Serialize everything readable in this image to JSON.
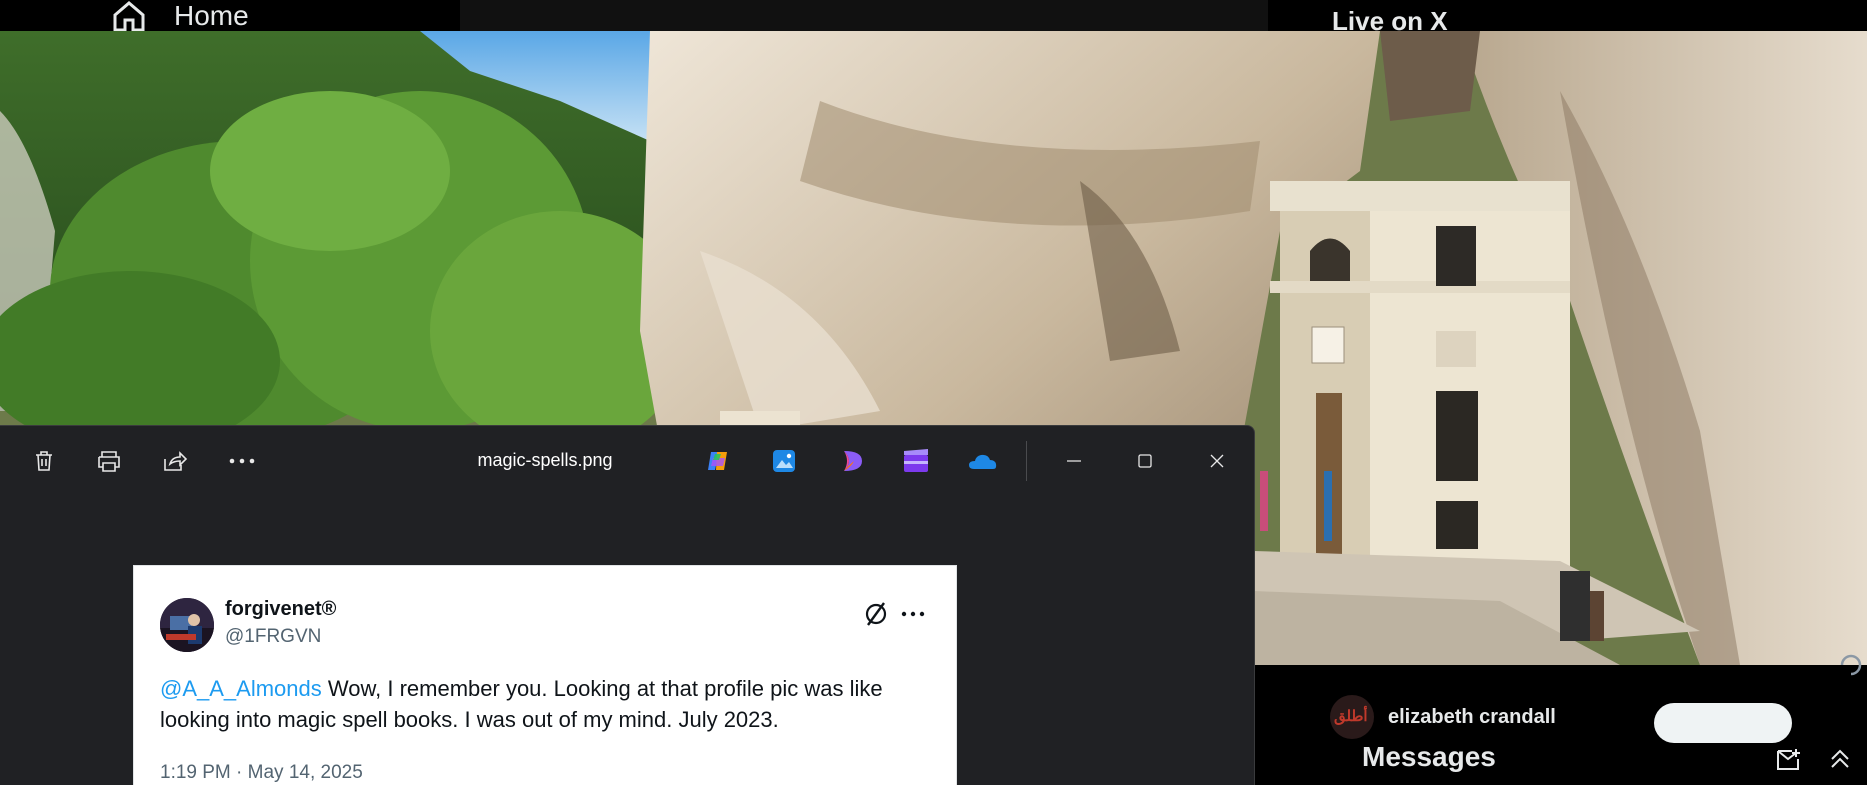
{
  "background_page": {
    "nav_home_label": "Home",
    "live_heading": "Live on X",
    "suggestion_name": "elizabeth crandall",
    "avatar_text": "أطلق",
    "messages_label": "Messages"
  },
  "viewer": {
    "filename": "magic-spells.png",
    "toolbar_icons": [
      "delete-icon",
      "print-icon",
      "share-icon",
      "more-icon"
    ],
    "app_icons": [
      "copilot-icon",
      "photos-icon",
      "designer-icon",
      "clipchamp-icon",
      "onedrive-icon"
    ],
    "window_controls": [
      "minimize",
      "maximize",
      "close"
    ]
  },
  "tweet": {
    "display_name": "forgivenet®",
    "handle": "@1FRGVN",
    "mention": "@A_A_Almonds",
    "body": " Wow, I remember you. Looking at that profile pic was like looking into magic spell books. I was out of my mind. July 2023.",
    "timestamp": "1:19 PM · May 14, 2025"
  },
  "colors": {
    "viewer_bg": "#202124",
    "mention_blue": "#1d9bf0",
    "text_dark": "#0f1419",
    "text_muted": "#536471"
  }
}
